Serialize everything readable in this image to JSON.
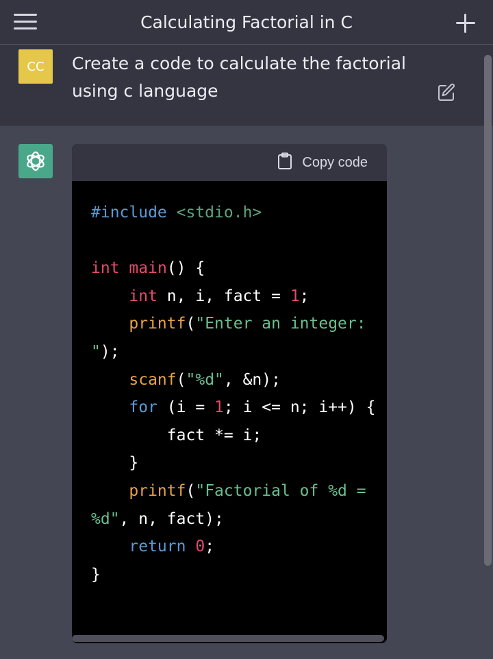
{
  "header": {
    "title": "Calculating Factorial in C"
  },
  "user_message": {
    "avatar_initials": "CC",
    "text": "Create a code to calculate the factorial using c language"
  },
  "code_block": {
    "copy_label": "Copy code",
    "language": "c",
    "lines": [
      "#include <stdio.h>",
      "",
      "int main() {",
      "    int n, i, fact = 1;",
      "    printf(\"Enter an integer: \");",
      "    scanf(\"%d\", &n);",
      "    for (i = 1; i <= n; i++) {",
      "        fact *= i;",
      "    }",
      "    printf(\"Factorial of %d = %d\", n, fact);",
      "    return 0;",
      "}"
    ]
  },
  "colors": {
    "header_bg": "#343541",
    "assistant_bg": "#444654",
    "user_avatar": "#e5c84a",
    "assistant_avatar": "#4aa88a",
    "code_bg": "#000000"
  },
  "icons": {
    "menu": "hamburger-menu-icon",
    "new_chat": "plus-icon",
    "edit": "edit-icon",
    "copy": "clipboard-icon",
    "assistant": "openai-logo-icon"
  }
}
